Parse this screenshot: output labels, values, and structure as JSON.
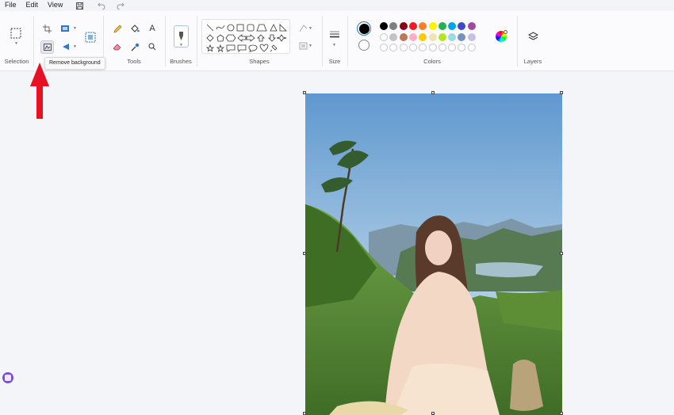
{
  "menu": {
    "file": "File",
    "edit": "Edit",
    "view": "View"
  },
  "quick_access": {
    "save_icon": "save-icon",
    "undo_icon": "undo-icon",
    "redo_icon": "redo-icon"
  },
  "groups": {
    "selection": "Selection",
    "tools": "Tools",
    "brushes": "Brushes",
    "shapes": "Shapes",
    "size": "Size",
    "colors": "Colors",
    "layers": "Layers"
  },
  "tooltip": "Remove background",
  "colors": {
    "primary": "#000000",
    "secondary": "#ffffff",
    "palette_row1": [
      "#000000",
      "#7f7f7f",
      "#880015",
      "#ed1c24",
      "#ff7f27",
      "#fff200",
      "#22b14c",
      "#00a2e8",
      "#3f48cc",
      "#a349a4"
    ],
    "palette_row2": [
      "#ffffff",
      "#c3c3c3",
      "#b97a57",
      "#ffaec9",
      "#ffc90e",
      "#efe4b0",
      "#b5e61d",
      "#99d9ea",
      "#7092be",
      "#c8bfe7"
    ],
    "palette_row3_empty_count": 10,
    "accent": "#e81123"
  }
}
